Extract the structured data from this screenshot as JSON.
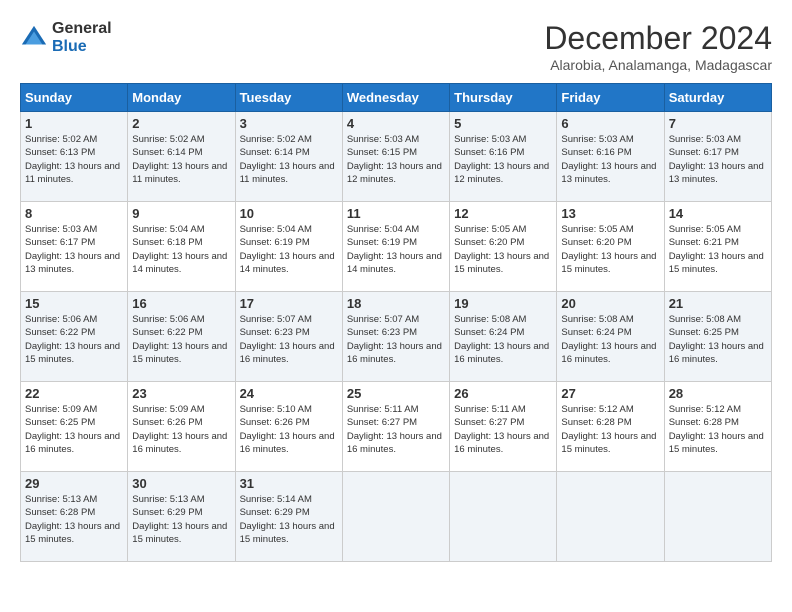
{
  "logo": {
    "general": "General",
    "blue": "Blue"
  },
  "header": {
    "month": "December 2024",
    "location": "Alarobia, Analamanga, Madagascar"
  },
  "weekdays": [
    "Sunday",
    "Monday",
    "Tuesday",
    "Wednesday",
    "Thursday",
    "Friday",
    "Saturday"
  ],
  "weeks": [
    [
      {
        "day": "1",
        "sunrise": "5:02 AM",
        "sunset": "6:13 PM",
        "daylight": "13 hours and 11 minutes."
      },
      {
        "day": "2",
        "sunrise": "5:02 AM",
        "sunset": "6:14 PM",
        "daylight": "13 hours and 11 minutes."
      },
      {
        "day": "3",
        "sunrise": "5:02 AM",
        "sunset": "6:14 PM",
        "daylight": "13 hours and 11 minutes."
      },
      {
        "day": "4",
        "sunrise": "5:03 AM",
        "sunset": "6:15 PM",
        "daylight": "13 hours and 12 minutes."
      },
      {
        "day": "5",
        "sunrise": "5:03 AM",
        "sunset": "6:16 PM",
        "daylight": "13 hours and 12 minutes."
      },
      {
        "day": "6",
        "sunrise": "5:03 AM",
        "sunset": "6:16 PM",
        "daylight": "13 hours and 13 minutes."
      },
      {
        "day": "7",
        "sunrise": "5:03 AM",
        "sunset": "6:17 PM",
        "daylight": "13 hours and 13 minutes."
      }
    ],
    [
      {
        "day": "8",
        "sunrise": "5:03 AM",
        "sunset": "6:17 PM",
        "daylight": "13 hours and 13 minutes."
      },
      {
        "day": "9",
        "sunrise": "5:04 AM",
        "sunset": "6:18 PM",
        "daylight": "13 hours and 14 minutes."
      },
      {
        "day": "10",
        "sunrise": "5:04 AM",
        "sunset": "6:19 PM",
        "daylight": "13 hours and 14 minutes."
      },
      {
        "day": "11",
        "sunrise": "5:04 AM",
        "sunset": "6:19 PM",
        "daylight": "13 hours and 14 minutes."
      },
      {
        "day": "12",
        "sunrise": "5:05 AM",
        "sunset": "6:20 PM",
        "daylight": "13 hours and 15 minutes."
      },
      {
        "day": "13",
        "sunrise": "5:05 AM",
        "sunset": "6:20 PM",
        "daylight": "13 hours and 15 minutes."
      },
      {
        "day": "14",
        "sunrise": "5:05 AM",
        "sunset": "6:21 PM",
        "daylight": "13 hours and 15 minutes."
      }
    ],
    [
      {
        "day": "15",
        "sunrise": "5:06 AM",
        "sunset": "6:22 PM",
        "daylight": "13 hours and 15 minutes."
      },
      {
        "day": "16",
        "sunrise": "5:06 AM",
        "sunset": "6:22 PM",
        "daylight": "13 hours and 15 minutes."
      },
      {
        "day": "17",
        "sunrise": "5:07 AM",
        "sunset": "6:23 PM",
        "daylight": "13 hours and 16 minutes."
      },
      {
        "day": "18",
        "sunrise": "5:07 AM",
        "sunset": "6:23 PM",
        "daylight": "13 hours and 16 minutes."
      },
      {
        "day": "19",
        "sunrise": "5:08 AM",
        "sunset": "6:24 PM",
        "daylight": "13 hours and 16 minutes."
      },
      {
        "day": "20",
        "sunrise": "5:08 AM",
        "sunset": "6:24 PM",
        "daylight": "13 hours and 16 minutes."
      },
      {
        "day": "21",
        "sunrise": "5:08 AM",
        "sunset": "6:25 PM",
        "daylight": "13 hours and 16 minutes."
      }
    ],
    [
      {
        "day": "22",
        "sunrise": "5:09 AM",
        "sunset": "6:25 PM",
        "daylight": "13 hours and 16 minutes."
      },
      {
        "day": "23",
        "sunrise": "5:09 AM",
        "sunset": "6:26 PM",
        "daylight": "13 hours and 16 minutes."
      },
      {
        "day": "24",
        "sunrise": "5:10 AM",
        "sunset": "6:26 PM",
        "daylight": "13 hours and 16 minutes."
      },
      {
        "day": "25",
        "sunrise": "5:11 AM",
        "sunset": "6:27 PM",
        "daylight": "13 hours and 16 minutes."
      },
      {
        "day": "26",
        "sunrise": "5:11 AM",
        "sunset": "6:27 PM",
        "daylight": "13 hours and 16 minutes."
      },
      {
        "day": "27",
        "sunrise": "5:12 AM",
        "sunset": "6:28 PM",
        "daylight": "13 hours and 15 minutes."
      },
      {
        "day": "28",
        "sunrise": "5:12 AM",
        "sunset": "6:28 PM",
        "daylight": "13 hours and 15 minutes."
      }
    ],
    [
      {
        "day": "29",
        "sunrise": "5:13 AM",
        "sunset": "6:28 PM",
        "daylight": "13 hours and 15 minutes."
      },
      {
        "day": "30",
        "sunrise": "5:13 AM",
        "sunset": "6:29 PM",
        "daylight": "13 hours and 15 minutes."
      },
      {
        "day": "31",
        "sunrise": "5:14 AM",
        "sunset": "6:29 PM",
        "daylight": "13 hours and 15 minutes."
      },
      null,
      null,
      null,
      null
    ]
  ]
}
